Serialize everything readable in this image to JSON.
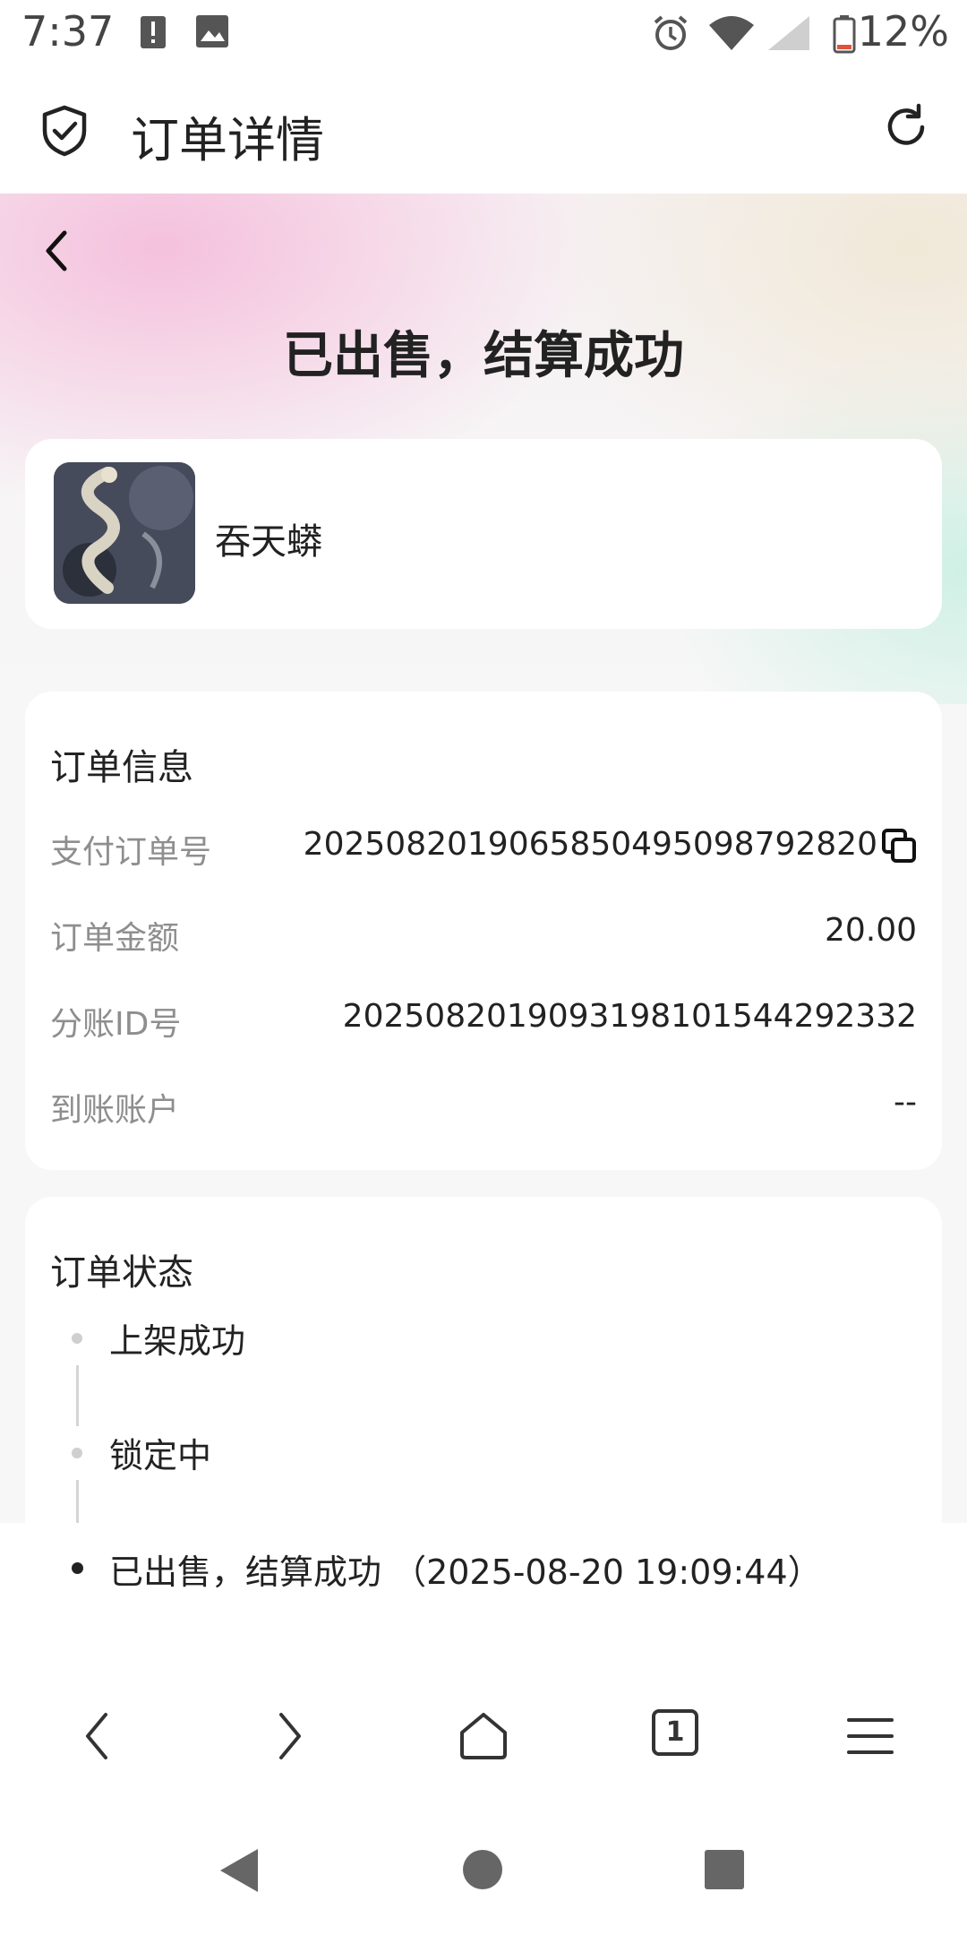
{
  "status_bar": {
    "time": "7:37",
    "battery_text": "12%",
    "icons": [
      "alert-icon",
      "image-icon",
      "alarm-icon",
      "wifi-icon",
      "signal-icon",
      "battery-icon"
    ]
  },
  "app_bar": {
    "title": "订单详情",
    "icons": [
      "shield-check-icon",
      "reload-icon"
    ]
  },
  "hero": {
    "title": "已出售，结算成功"
  },
  "product": {
    "name": "吞天蟒"
  },
  "order_info": {
    "section_title": "订单信息",
    "rows": [
      {
        "label": "支付订单号",
        "value": "202508201906585049509879282​0"
      },
      {
        "label": "订单金额",
        "value": "20.00"
      },
      {
        "label": "分账ID号",
        "value": "20250820190931981015442923​32"
      },
      {
        "label": "到账账户",
        "value": "--"
      }
    ]
  },
  "order_status": {
    "section_title": "订单状态",
    "steps": [
      {
        "label": "上架成功"
      },
      {
        "label": "锁定中"
      },
      {
        "label": "已出售，结算成功 （2025-08-20 19:09:44）"
      }
    ]
  },
  "browser_nav": {
    "tab_count": "1",
    "icons": [
      "back-icon",
      "forward-icon",
      "home-icon",
      "tabs-icon",
      "menu-icon"
    ]
  },
  "system_nav": {
    "icons": [
      "system-back-icon",
      "system-home-icon",
      "system-recents-icon"
    ]
  },
  "colors": {
    "accent_text": "#222222",
    "label_gray": "#8e8e8e",
    "hero_pink": "#f5bedc",
    "hero_mint": "#cdf0e4"
  }
}
